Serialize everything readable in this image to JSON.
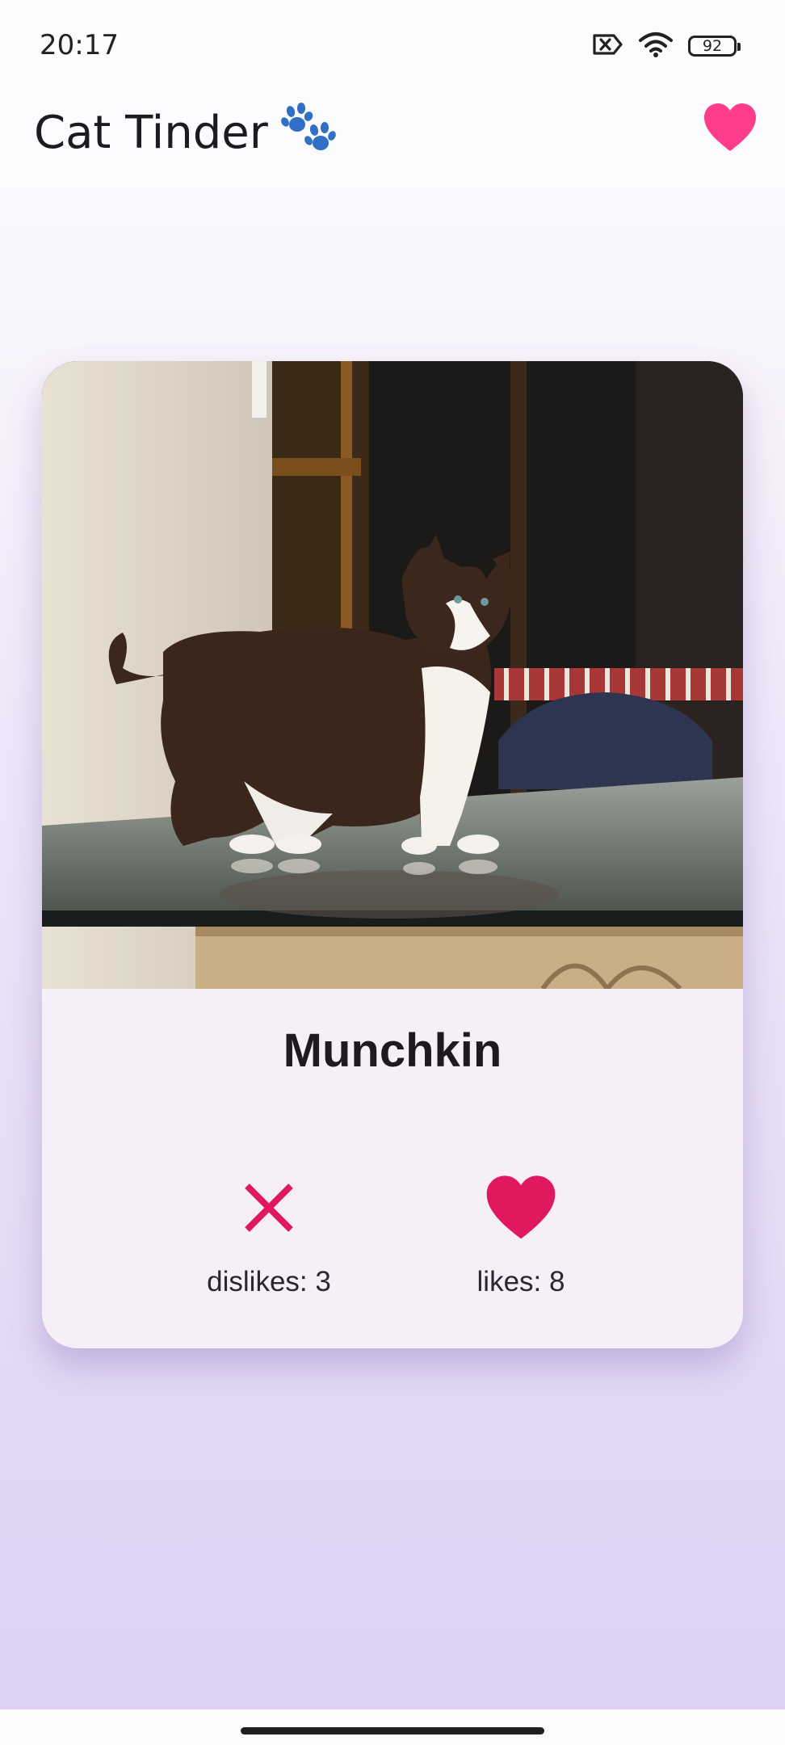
{
  "status_bar": {
    "time": "20:17",
    "battery": "92",
    "icons": [
      "no-sim-icon",
      "wifi-icon",
      "battery-icon"
    ]
  },
  "app_bar": {
    "title": "Cat Tinder",
    "title_icon": "paw-icon",
    "action_icon": "heart-icon"
  },
  "card": {
    "image": "cat-photo",
    "name": "Munchkin",
    "dislike": {
      "icon": "close-icon",
      "label": "dislikes: 3"
    },
    "like": {
      "icon": "heart-icon",
      "label": "likes: 8"
    }
  },
  "colors": {
    "accent_pink": "#ff3d8b",
    "action_pink": "#e0195f",
    "paw_blue": "#2f6fc5",
    "card_background": "#f6eff8",
    "gradient_bottom": "#ddd2f3"
  }
}
